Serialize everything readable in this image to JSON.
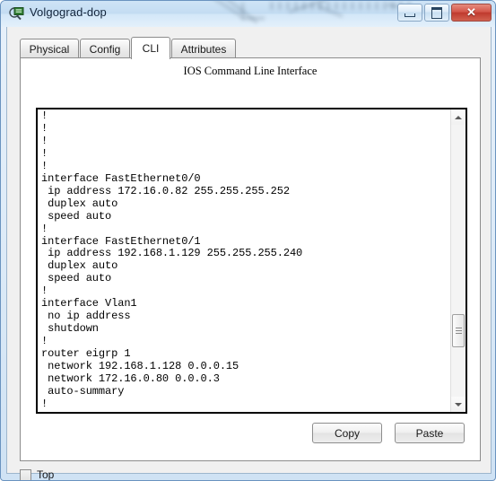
{
  "window": {
    "title": "Volgograd-dop",
    "icon": "packet-tracer-device-icon",
    "controls": {
      "minimize": "–",
      "maximize": "□",
      "close": "✕"
    }
  },
  "tabs": [
    {
      "label": "Physical",
      "active": false
    },
    {
      "label": "Config",
      "active": false
    },
    {
      "label": "CLI",
      "active": true
    },
    {
      "label": "Attributes",
      "active": false
    }
  ],
  "panel": {
    "title": "IOS Command Line Interface",
    "console_text": "!\n!\n!\n!\n!\ninterface FastEthernet0/0\n ip address 172.16.0.82 255.255.255.252\n duplex auto\n speed auto\n!\ninterface FastEthernet0/1\n ip address 192.168.1.129 255.255.255.240\n duplex auto\n speed auto\n!\ninterface Vlan1\n no ip address\n shutdown\n!\nrouter eigrp 1\n network 192.168.1.128 0.0.0.15\n network 172.16.0.80 0.0.0.3\n auto-summary\n!"
  },
  "buttons": {
    "copy": "Copy",
    "paste": "Paste"
  },
  "bottom": {
    "top_checkbox_label": "Top",
    "top_checkbox_checked": false
  },
  "scrollbar": {
    "up_arrow": "scroll-up-arrow",
    "down_arrow": "scroll-down-arrow",
    "thumb_position_percent": 72
  },
  "colors": {
    "titlebar": "#c3dcf2",
    "close_button": "#bf3a2e",
    "panel_background": "#ffffff",
    "client_background": "#f0f0f0",
    "console_text": "#000000"
  }
}
